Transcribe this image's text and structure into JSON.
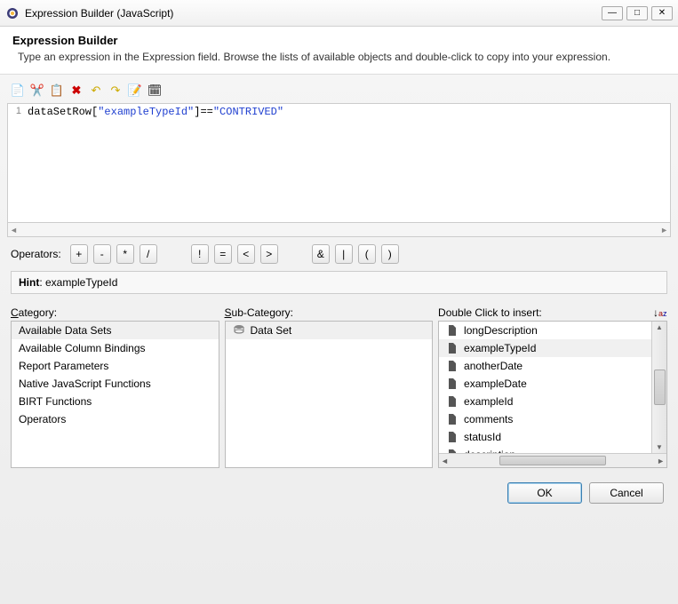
{
  "window": {
    "title": "Expression Builder (JavaScript)"
  },
  "header": {
    "title": "Expression Builder",
    "subtitle": "Type an expression in the Expression field. Browse the lists of available objects and double-click to copy into your expression."
  },
  "editor": {
    "line_number": "1",
    "expr_prefix": "dataSetRow[",
    "expr_str1": "\"exampleTypeId\"",
    "expr_mid": "]==",
    "expr_str2": "\"CONTRIVED\""
  },
  "operators": {
    "label": "Operators:",
    "b1": "+",
    "b2": "-",
    "b3": "*",
    "b4": "/",
    "b5": "!",
    "b6": "=",
    "b7": "<",
    "b8": ">",
    "b9": "&",
    "b10": "|",
    "b11": "(",
    "b12": ")"
  },
  "hint": {
    "label": "Hint",
    "value": "exampleTypeId"
  },
  "columns": {
    "category_label": "Category:",
    "subcategory_label": "Sub-Category:",
    "insert_label": "Double Click to insert:"
  },
  "categories": {
    "items": [
      {
        "label": "Available Data Sets",
        "selected": true
      },
      {
        "label": "Available Column Bindings",
        "selected": false
      },
      {
        "label": "Report Parameters",
        "selected": false
      },
      {
        "label": "Native JavaScript Functions",
        "selected": false
      },
      {
        "label": "BIRT Functions",
        "selected": false
      },
      {
        "label": "Operators",
        "selected": false
      }
    ]
  },
  "subcategory": {
    "item": "Data Set"
  },
  "inserts": {
    "items": [
      {
        "label": "longDescription",
        "selected": false
      },
      {
        "label": "exampleTypeId",
        "selected": true
      },
      {
        "label": "anotherDate",
        "selected": false
      },
      {
        "label": "exampleDate",
        "selected": false
      },
      {
        "label": "exampleId",
        "selected": false
      },
      {
        "label": "comments",
        "selected": false
      },
      {
        "label": "statusId",
        "selected": false
      },
      {
        "label": "description",
        "selected": false
      }
    ]
  },
  "buttons": {
    "ok": "OK",
    "cancel": "Cancel"
  }
}
